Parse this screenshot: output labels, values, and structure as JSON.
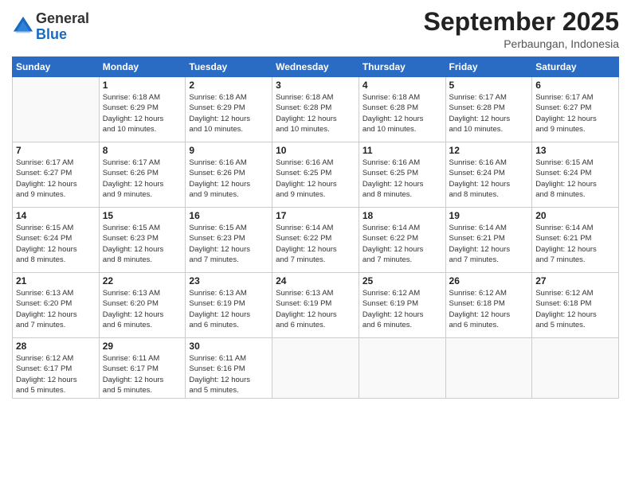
{
  "header": {
    "logo": {
      "general": "General",
      "blue": "Blue"
    },
    "title": "September 2025",
    "location": "Perbaungan, Indonesia"
  },
  "weekdays": [
    "Sunday",
    "Monday",
    "Tuesday",
    "Wednesday",
    "Thursday",
    "Friday",
    "Saturday"
  ],
  "weeks": [
    [
      {
        "day": "",
        "info": ""
      },
      {
        "day": "1",
        "info": "Sunrise: 6:18 AM\nSunset: 6:29 PM\nDaylight: 12 hours\nand 10 minutes."
      },
      {
        "day": "2",
        "info": "Sunrise: 6:18 AM\nSunset: 6:29 PM\nDaylight: 12 hours\nand 10 minutes."
      },
      {
        "day": "3",
        "info": "Sunrise: 6:18 AM\nSunset: 6:28 PM\nDaylight: 12 hours\nand 10 minutes."
      },
      {
        "day": "4",
        "info": "Sunrise: 6:18 AM\nSunset: 6:28 PM\nDaylight: 12 hours\nand 10 minutes."
      },
      {
        "day": "5",
        "info": "Sunrise: 6:17 AM\nSunset: 6:28 PM\nDaylight: 12 hours\nand 10 minutes."
      },
      {
        "day": "6",
        "info": "Sunrise: 6:17 AM\nSunset: 6:27 PM\nDaylight: 12 hours\nand 9 minutes."
      }
    ],
    [
      {
        "day": "7",
        "info": "Sunrise: 6:17 AM\nSunset: 6:27 PM\nDaylight: 12 hours\nand 9 minutes."
      },
      {
        "day": "8",
        "info": "Sunrise: 6:17 AM\nSunset: 6:26 PM\nDaylight: 12 hours\nand 9 minutes."
      },
      {
        "day": "9",
        "info": "Sunrise: 6:16 AM\nSunset: 6:26 PM\nDaylight: 12 hours\nand 9 minutes."
      },
      {
        "day": "10",
        "info": "Sunrise: 6:16 AM\nSunset: 6:25 PM\nDaylight: 12 hours\nand 9 minutes."
      },
      {
        "day": "11",
        "info": "Sunrise: 6:16 AM\nSunset: 6:25 PM\nDaylight: 12 hours\nand 8 minutes."
      },
      {
        "day": "12",
        "info": "Sunrise: 6:16 AM\nSunset: 6:24 PM\nDaylight: 12 hours\nand 8 minutes."
      },
      {
        "day": "13",
        "info": "Sunrise: 6:15 AM\nSunset: 6:24 PM\nDaylight: 12 hours\nand 8 minutes."
      }
    ],
    [
      {
        "day": "14",
        "info": "Sunrise: 6:15 AM\nSunset: 6:24 PM\nDaylight: 12 hours\nand 8 minutes."
      },
      {
        "day": "15",
        "info": "Sunrise: 6:15 AM\nSunset: 6:23 PM\nDaylight: 12 hours\nand 8 minutes."
      },
      {
        "day": "16",
        "info": "Sunrise: 6:15 AM\nSunset: 6:23 PM\nDaylight: 12 hours\nand 7 minutes."
      },
      {
        "day": "17",
        "info": "Sunrise: 6:14 AM\nSunset: 6:22 PM\nDaylight: 12 hours\nand 7 minutes."
      },
      {
        "day": "18",
        "info": "Sunrise: 6:14 AM\nSunset: 6:22 PM\nDaylight: 12 hours\nand 7 minutes."
      },
      {
        "day": "19",
        "info": "Sunrise: 6:14 AM\nSunset: 6:21 PM\nDaylight: 12 hours\nand 7 minutes."
      },
      {
        "day": "20",
        "info": "Sunrise: 6:14 AM\nSunset: 6:21 PM\nDaylight: 12 hours\nand 7 minutes."
      }
    ],
    [
      {
        "day": "21",
        "info": "Sunrise: 6:13 AM\nSunset: 6:20 PM\nDaylight: 12 hours\nand 7 minutes."
      },
      {
        "day": "22",
        "info": "Sunrise: 6:13 AM\nSunset: 6:20 PM\nDaylight: 12 hours\nand 6 minutes."
      },
      {
        "day": "23",
        "info": "Sunrise: 6:13 AM\nSunset: 6:19 PM\nDaylight: 12 hours\nand 6 minutes."
      },
      {
        "day": "24",
        "info": "Sunrise: 6:13 AM\nSunset: 6:19 PM\nDaylight: 12 hours\nand 6 minutes."
      },
      {
        "day": "25",
        "info": "Sunrise: 6:12 AM\nSunset: 6:19 PM\nDaylight: 12 hours\nand 6 minutes."
      },
      {
        "day": "26",
        "info": "Sunrise: 6:12 AM\nSunset: 6:18 PM\nDaylight: 12 hours\nand 6 minutes."
      },
      {
        "day": "27",
        "info": "Sunrise: 6:12 AM\nSunset: 6:18 PM\nDaylight: 12 hours\nand 5 minutes."
      }
    ],
    [
      {
        "day": "28",
        "info": "Sunrise: 6:12 AM\nSunset: 6:17 PM\nDaylight: 12 hours\nand 5 minutes."
      },
      {
        "day": "29",
        "info": "Sunrise: 6:11 AM\nSunset: 6:17 PM\nDaylight: 12 hours\nand 5 minutes."
      },
      {
        "day": "30",
        "info": "Sunrise: 6:11 AM\nSunset: 6:16 PM\nDaylight: 12 hours\nand 5 minutes."
      },
      {
        "day": "",
        "info": ""
      },
      {
        "day": "",
        "info": ""
      },
      {
        "day": "",
        "info": ""
      },
      {
        "day": "",
        "info": ""
      }
    ]
  ]
}
